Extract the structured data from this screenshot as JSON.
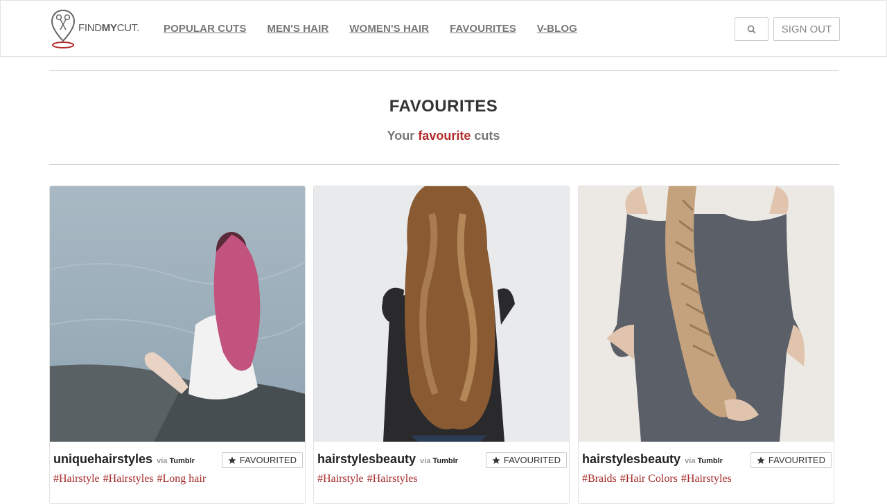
{
  "header": {
    "logo": {
      "text_regular": "FIND",
      "text_bold": "MY",
      "text_end": "CUT.",
      "icon": "scissors-pin-icon"
    },
    "nav": [
      "POPULAR CUTS",
      "MEN'S HAIR",
      "WOMEN'S HAIR",
      "FAVOURITES",
      "V-BLOG"
    ],
    "search_icon": "search-icon",
    "signout_label": "SIGN OUT"
  },
  "page": {
    "title": "FAVOURITES",
    "subtitle_pre": "Your ",
    "subtitle_accent": "favourite",
    "subtitle_post": " cuts"
  },
  "colors": {
    "accent": "#b22a2a",
    "nav_text": "#777777"
  },
  "cards": [
    {
      "user": "uniquehairstyles",
      "via": "via",
      "source": "Tumblr",
      "fav_label": "FAVOURITED",
      "fav_icon": "star-icon",
      "tags": [
        "#Hairstyle",
        "#Hairstyles",
        "#Long hair"
      ]
    },
    {
      "user": "hairstylesbeauty",
      "via": "via",
      "source": "Tumblr",
      "fav_label": "FAVOURITED",
      "fav_icon": "star-icon",
      "tags": [
        "#Hairstyle",
        "#Hairstyles"
      ]
    },
    {
      "user": "hairstylesbeauty",
      "via": "via",
      "source": "Tumblr",
      "fav_label": "FAVOURITED",
      "fav_icon": "star-icon",
      "tags": [
        "#Braids",
        "#Hair Colors",
        "#Hairstyles"
      ]
    }
  ]
}
